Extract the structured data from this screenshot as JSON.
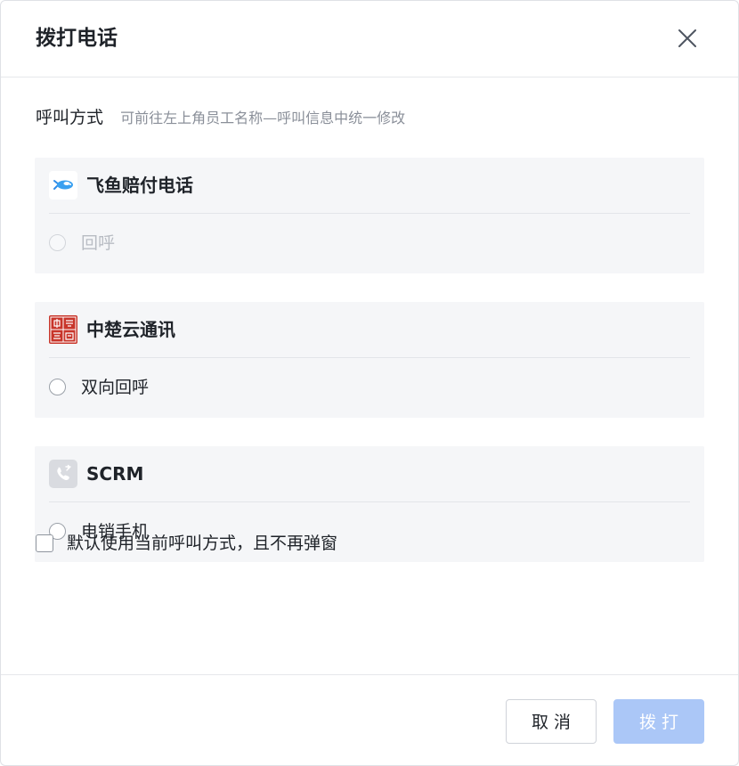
{
  "dialog": {
    "title": "拨打电话"
  },
  "call_method": {
    "label": "呼叫方式",
    "hint": "可前往左上角员工名称—呼叫信息中统一修改"
  },
  "providers": [
    {
      "name": "飞鱼赔付电话",
      "logo_icon": "fish-logo-icon",
      "option": "回呼",
      "option_disabled": true
    },
    {
      "name": "中楚云通讯",
      "logo_icon": "seal-logo-icon",
      "option": "双向回呼",
      "option_disabled": false
    },
    {
      "name": "SCRM",
      "logo_icon": "phone-logo-icon",
      "option": "电销手机",
      "option_disabled": false
    }
  ],
  "default_option": {
    "label": "默认使用当前呼叫方式，且不再弹窗",
    "checked": false
  },
  "footer": {
    "cancel_label": "取消",
    "dial_label": "拨打"
  },
  "colors": {
    "primary_disabled": "#abc7f7",
    "card_bg": "#f5f6f8",
    "seal_red": "#c8352a"
  }
}
